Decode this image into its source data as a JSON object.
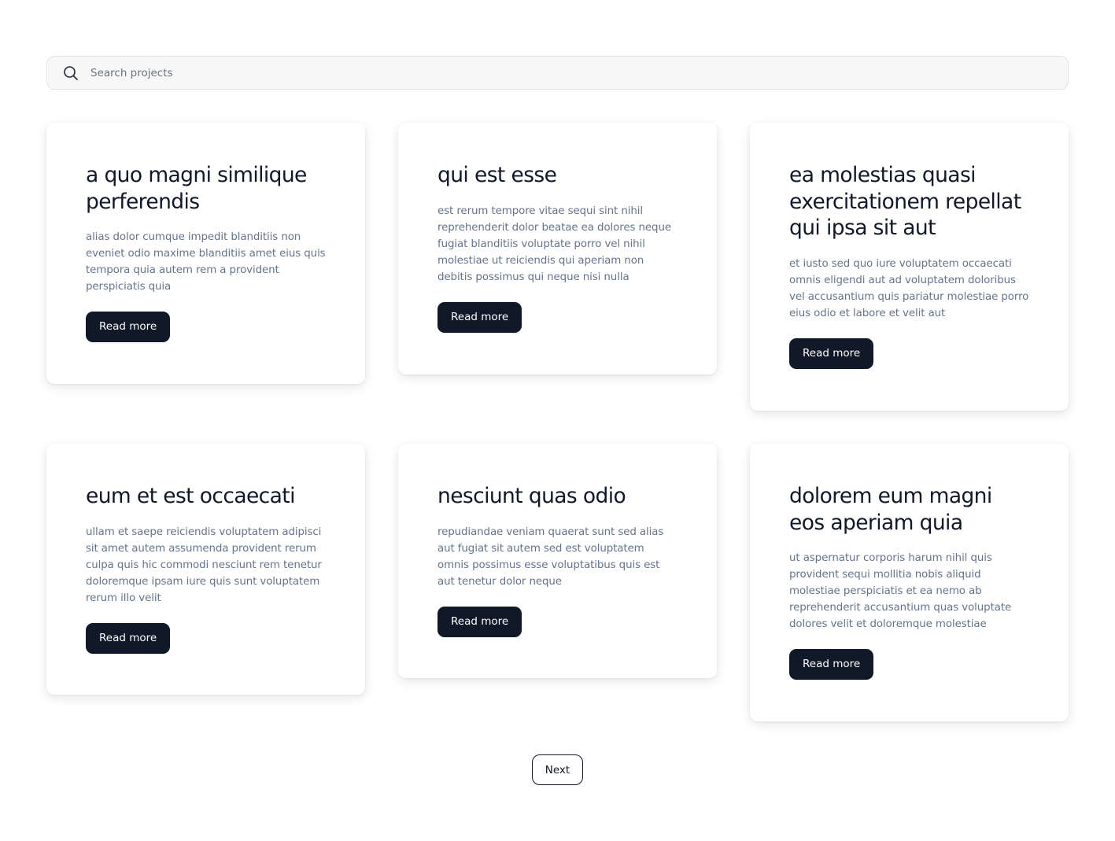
{
  "search": {
    "placeholder": "Search projects",
    "icon": "search-icon"
  },
  "cards": [
    {
      "title": "a quo magni similique perferendis",
      "body": "alias dolor cumque impedit blanditiis non eveniet odio maxime blanditiis amet eius quis tempora quia autem rem a provident perspiciatis quia",
      "button": "Read more"
    },
    {
      "title": "qui est esse",
      "body": "est rerum tempore vitae sequi sint nihil reprehenderit dolor beatae ea dolores neque fugiat blanditiis voluptate porro vel nihil molestiae ut reiciendis qui aperiam non debitis possimus qui neque nisi nulla",
      "button": "Read more"
    },
    {
      "title": "ea molestias quasi exercitationem repellat qui ipsa sit aut",
      "body": "et iusto sed quo iure voluptatem occaecati omnis eligendi aut ad voluptatem doloribus vel accusantium quis pariatur molestiae porro eius odio et labore et velit aut",
      "button": "Read more"
    },
    {
      "title": "eum et est occaecati",
      "body": "ullam et saepe reiciendis voluptatem adipisci sit amet autem assumenda provident rerum culpa quis hic commodi nesciunt rem tenetur doloremque ipsam iure quis sunt voluptatem rerum illo velit",
      "button": "Read more"
    },
    {
      "title": "nesciunt quas odio",
      "body": "repudiandae veniam quaerat sunt sed alias aut fugiat sit autem sed est voluptatem omnis possimus esse voluptatibus quis est aut tenetur dolor neque",
      "button": "Read more"
    },
    {
      "title": "dolorem eum magni eos aperiam quia",
      "body": "ut aspernatur corporis harum nihil quis provident sequi mollitia nobis aliquid molestiae perspiciatis et ea nemo ab reprehenderit accusantium quas voluptate dolores velit et doloremque molestiae",
      "button": "Read more"
    }
  ],
  "pagination": {
    "next_label": "Next"
  },
  "colors": {
    "button_bg": "#111827",
    "title": "#111827",
    "body_text": "#64748b",
    "search_bg": "#f7f7f7"
  }
}
